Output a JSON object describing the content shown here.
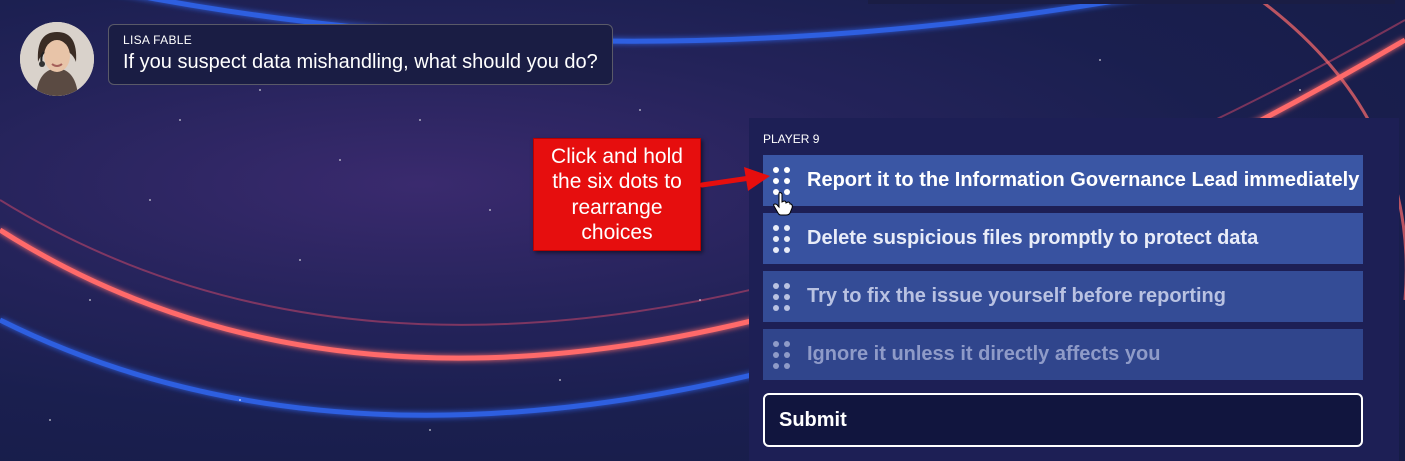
{
  "speaker": {
    "name": "LISA FABLE",
    "question": "If you suspect data mishandling, what should you do?"
  },
  "panel": {
    "player_label": "PLAYER 9",
    "choices": [
      {
        "label": "Report it to the Information Governance Lead immediately",
        "bg": "#3a56a4",
        "text_color": "#ffffff"
      },
      {
        "label": "Delete suspicious files promptly to protect data",
        "bg": "#3852a0",
        "text_color": "#e8ecf8"
      },
      {
        "label": "Try to fix the issue yourself before reporting",
        "bg": "#344c96",
        "text_color": "#b9c2e2"
      },
      {
        "label": "Ignore it unless it directly affects you",
        "bg": "#30458c",
        "text_color": "#8f9bc8"
      }
    ],
    "submit_label": "Submit"
  },
  "callout": {
    "text": "Click and hold the six dots to rearrange choices",
    "color": "#e60e0e"
  },
  "icons": [
    "drag-handle-icon",
    "hand-cursor-icon",
    "arrow-icon"
  ]
}
